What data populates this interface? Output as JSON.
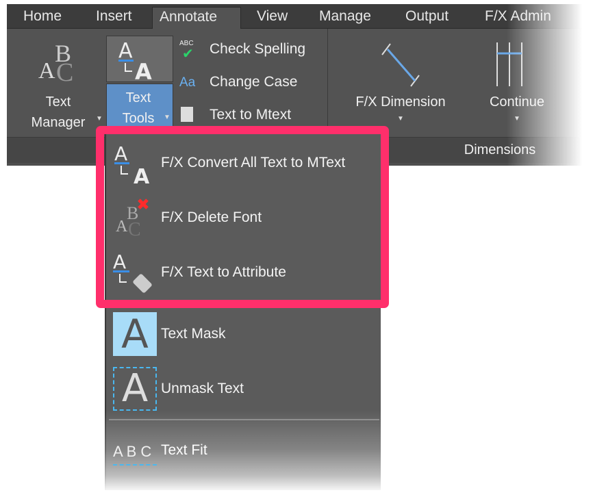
{
  "tabs": [
    "Home",
    "Insert",
    "Annotate",
    "View",
    "Manage",
    "Output",
    "F/X Admin"
  ],
  "active_tab": "Annotate",
  "ribbon": {
    "text_manager": [
      "Text",
      "Manager"
    ],
    "text_tools": [
      "Text",
      "Tools"
    ],
    "check_spelling": "Check Spelling",
    "change_case": "Change Case",
    "text_to_mtext": "Text to Mtext",
    "fx_dimension": "F/X Dimension",
    "continue": "Continue",
    "dimensions_panel": "Dimensions",
    "abc_icon_text": "ABC",
    "change_case_icon_text": "Aa"
  },
  "menu": {
    "items": [
      {
        "label": "F/X Convert All Text to MText",
        "icon": "text-convert-icon"
      },
      {
        "label": "F/X Delete Font",
        "icon": "delete-font-icon"
      },
      {
        "label": "F/X Text to Attribute",
        "icon": "text-to-attribute-icon"
      },
      {
        "label": "Text Mask",
        "icon": "text-mask-icon"
      },
      {
        "label": "Unmask Text",
        "icon": "unmask-text-icon"
      },
      {
        "label": "Text Fit",
        "icon": "text-fit-icon"
      }
    ],
    "text_fit_icon_text": "A B C"
  },
  "colors": {
    "highlight": "#ff2f6b",
    "accent_blue": "#6aa8e8",
    "mask_bg": "#a8dcf8"
  }
}
